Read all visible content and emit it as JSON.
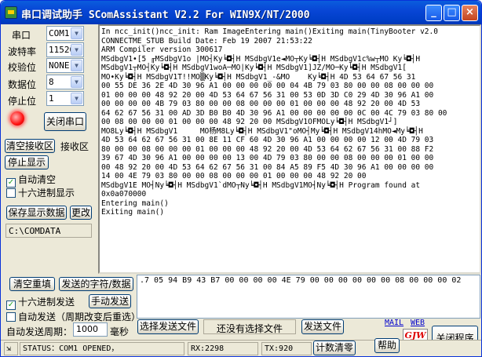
{
  "window": {
    "title": "串口调试助手  SComAssistant V2.2 For WIN9X/NT/2000",
    "min_glyph": "_",
    "max_glyph": "□",
    "close_glyph": "×"
  },
  "settings": {
    "port_label": "串口",
    "port_value": "COM1",
    "baud_label": "波特率",
    "baud_value": "115200",
    "parity_label": "校验位",
    "parity_value": "NONE",
    "databits_label": "数据位",
    "databits_value": "8",
    "stopbits_label": "停止位",
    "stopbits_value": "1",
    "close_port_label": "关闭串口"
  },
  "receive": {
    "clear_label": "清空接收区",
    "area_label": "接收区",
    "stop_display_label": "停止显示",
    "auto_clear_label": "自动清空",
    "auto_clear_checked": true,
    "hex_display_label": "十六进制显示",
    "hex_display_checked": false,
    "save_data_label": "保存显示数据",
    "change_label": "更改",
    "path_value": "C:\\COMDATA"
  },
  "output_lines": [
    "In ncc_init()ncc_init: Ram ImageEntering main()Exiting main(TinyBooter v2.0",
    "CONNECTME_STUB Build Date: Feb 19 2007 21:53:22",
    "ARM Compiler version 300617",
    "MSdbgV1•[5 ╓MSdbgV1o |MO┤Ky╘◘┤H MSdbgV1e◄MO┬Ky╘◘┤H MSdbgV1c%w┬MO Ky╘◘┤H",
    "MSdbgV1┬MO┤Ky╘◘┤H MSdbgV1woA─MO|Ky╘◘┤H MSdbgV1]JZ/MO─Ky╘◘┤H MSdbgV1[",
    "MO•Ky╘◘┤H MSdbgV1T!!MO▒Ky╘◘┤H MSdbgV1_-&MO    Ky╘◘┤H 4D 53 64 67 56 31",
    "00 55 DE 36 2E 4D 30 96 A1 00 00 00 00 00 04 4B 79 03 80 00 00 08 00 00 00",
    "01 00 00 00 48 92 20 00 4D 53 64 67 56 31 00 53 0D 3D C0 29 4D 30 96 A1 00",
    "00 00 00 00 4B 79 03 80 00 00 08 00 00 00 01 00 00 00 48 92 20 00 4D 53",
    "64 62 67 56 31 00 AD 3D B0 B0 4D 30 96 A1 00 00 00 00 00 0C 00 4C 79 03 80 00",
    "00 08 00 00 00 01 00 00 00 48 92 20 00 MSdbgV1OFMOLy╘◘┤H MSdbgV1┘]",
    "MO8Ly╘◘┤H MSdbgV1     MO杨M8Ly╘◘┤H MSdbgV1\"oMO┤My╘◘┤H MSdbgV14hMO◄My╘◘┤H",
    "4D 53 64 62 67 56 31 00 8E 11 CF 60 4D 30 96 A1 00 00 00 00 12 00 4D 79 03",
    "80 00 00 08 00 00 00 01 00 00 00 48 92 20 00 4D 53 64 62 67 56 31 00 88 F2",
    "39 67 4D 30 96 A1 00 00 00 00 13 00 4D 79 03 80 00 00 08 00 00 00 01 00 00",
    "00 48 92 20 00 4D 53 64 62 67 56 31 00 84 A5 89 F5 4D 30 96 A1 00 00 00 00",
    "14 00 4E 79 03 80 00 00 08 00 00 00 01 00 00 00 48 92 20 00",
    "MSdbgV1E MO┤Ny╘◘┤H MSdbgV1`dMO┬Ny╘◘┤H MSdbgV1MO┤Ny╘◘┤H Program found at",
    "0x0a070000",
    "Entering main()",
    "Exiting main()"
  ],
  "send": {
    "clear_resend_label": "清空重填",
    "send_chars_label": "发送的字符/数据",
    "send_value": ".7 05 94 B9 43 B7 00 00 00 00 4E 79 00 00 00 00 00 00 08 00 00 00 02",
    "hex_send_label": "十六进制发送",
    "hex_send_checked": true,
    "manual_send_label": "手动发送",
    "auto_send_label": "自动发送（周期改变后重选）",
    "auto_send_checked": false,
    "period_label": "自动发送周期：",
    "period_value": "1000",
    "period_unit": "毫秒",
    "select_file_label": "选择发送文件",
    "no_file_label": "还没有选择文件",
    "send_file_label": "发送文件",
    "mail_label": "MAIL",
    "web_label": "WEB",
    "close_program_label": "关闭程序",
    "help_label": "帮助",
    "logo_text": "GJW TECH"
  },
  "status": {
    "status_text": "STATUS：COM1 OPENED，",
    "rx_text": "RX:2298",
    "tx_text": "TX:920",
    "reset_count_label": "计数清零"
  }
}
